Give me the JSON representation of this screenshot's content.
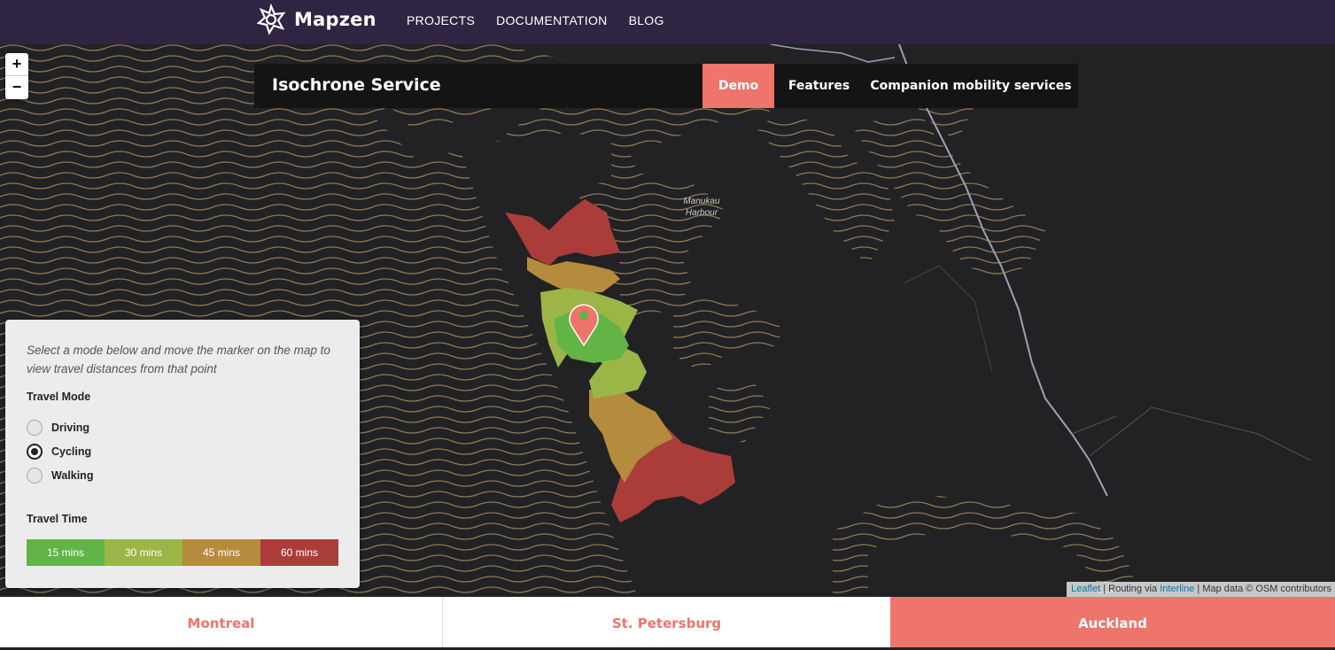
{
  "brand": {
    "name": "Mapzen"
  },
  "nav": {
    "projects": "PROJECTS",
    "documentation": "DOCUMENTATION",
    "blog": "BLOG"
  },
  "zoom": {
    "in": "+",
    "out": "−"
  },
  "header": {
    "title": "Isochrone Service",
    "tabs": {
      "demo": "Demo",
      "features": "Features",
      "companion": "Companion mobility services"
    },
    "active_tab": "Demo"
  },
  "map": {
    "label_line1": "Manukau",
    "label_line2": "Harbour"
  },
  "panel": {
    "instructions": "Select a mode below and move the marker on the map to view travel distances from that point",
    "travel_mode_label": "Travel Mode",
    "modes": {
      "driving": "Driving",
      "cycling": "Cycling",
      "walking": "Walking"
    },
    "selected_mode": "Cycling",
    "travel_time_label": "Travel Time",
    "times": {
      "t15": "15 mins",
      "t30": "30 mins",
      "t45": "45 mins",
      "t60": "60 mins"
    }
  },
  "colors": {
    "accent": "#ee746c",
    "nav_bg": "#2f2542",
    "iso_15": "#62b446",
    "iso_30": "#9bb646",
    "iso_45": "#b58b3d",
    "iso_60": "#aa3d3a"
  },
  "attribution": {
    "leaflet": "Leaflet",
    "routing_prefix": " | Routing via ",
    "interline": "Interline",
    "map_data": " | Map data © OSM contributors"
  },
  "cities": {
    "montreal": "Montreal",
    "st_petersburg": "St. Petersburg",
    "auckland": "Auckland"
  },
  "selected_city": "Auckland"
}
